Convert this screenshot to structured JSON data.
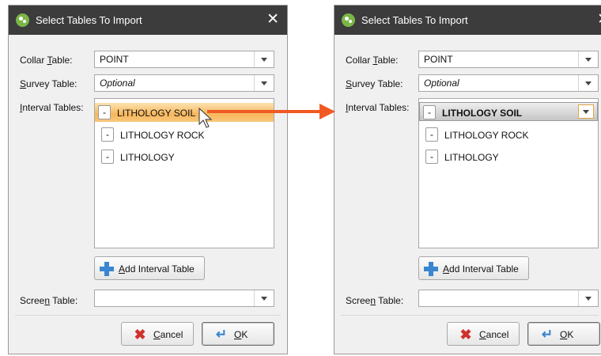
{
  "dialog_title": "Select Tables To Import",
  "close_glyph": "✕",
  "labels": {
    "collar_prefix": "Collar ",
    "collar_key": "T",
    "collar_suffix": "able:",
    "survey_key": "S",
    "survey_suffix": "urvey Table:",
    "interval_key": "I",
    "interval_suffix": "nterval Tables:",
    "screen_prefix": "Scree",
    "screen_key": "n",
    "screen_suffix": " Table:"
  },
  "fields": {
    "collar_value": "POINT",
    "survey_value": "Optional",
    "screen_value": ""
  },
  "interval_items": [
    "LITHOLOGY SOIL",
    "LITHOLOGY ROCK",
    "LITHOLOGY"
  ],
  "minus_glyph": "-",
  "buttons": {
    "add_key": "A",
    "add_rest": "dd Interval Table",
    "cancel_key": "C",
    "cancel_rest": "ancel",
    "ok_prefix": "O",
    "ok_key": "K"
  },
  "icons": [
    "app-icon",
    "close-icon",
    "chevron-down-icon",
    "add-icon",
    "cancel-icon",
    "ok-icon",
    "mouse-cursor-icon",
    "arrow-icon"
  ],
  "colors": {
    "titlebar": "#3c3c3c",
    "highlight": "#f7b75c",
    "arrow": "#f05a22",
    "selected": "#c6c6c6"
  }
}
